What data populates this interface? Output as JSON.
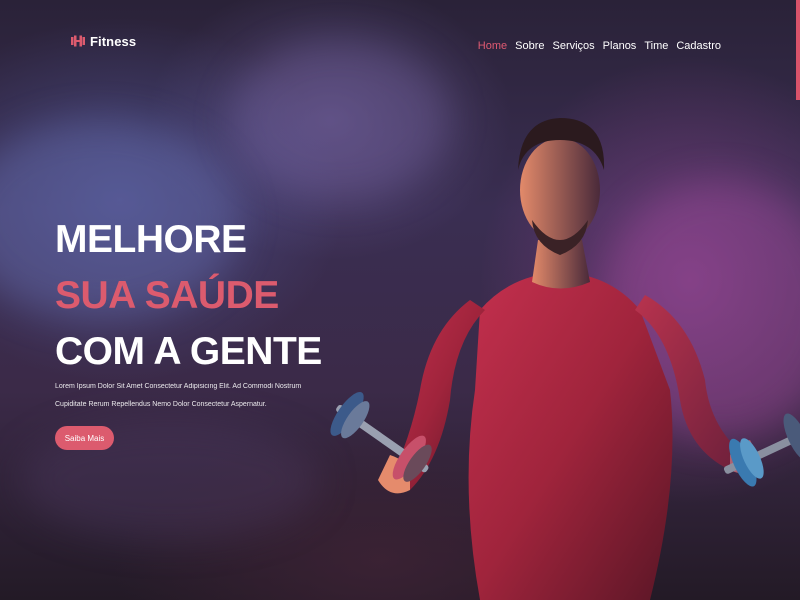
{
  "brand": {
    "name": "Fitness",
    "icon": "dumbbell-icon",
    "accent": "#dc5b6e"
  },
  "nav": [
    {
      "label": "Home",
      "active": true
    },
    {
      "label": "Sobre",
      "active": false
    },
    {
      "label": "Serviços",
      "active": false
    },
    {
      "label": "Planos",
      "active": false
    },
    {
      "label": "Time",
      "active": false
    },
    {
      "label": "Cadastro",
      "active": false
    }
  ],
  "hero": {
    "line1": "MELHORE",
    "line2": "SUA SAÚDE",
    "line3": "COM A GENTE",
    "description": "Lorem Ipsum Dolor Sit Amet Consectetur Adipisicing Elit. Ad Commodi Nostrum Cupiditate Rerum Repellendus Nemo Dolor Consectetur Aspernatur.",
    "cta_label": "Saiba Mais"
  },
  "colors": {
    "accent": "#dc5b6e",
    "text": "#ffffff",
    "background": "#2a2238"
  }
}
